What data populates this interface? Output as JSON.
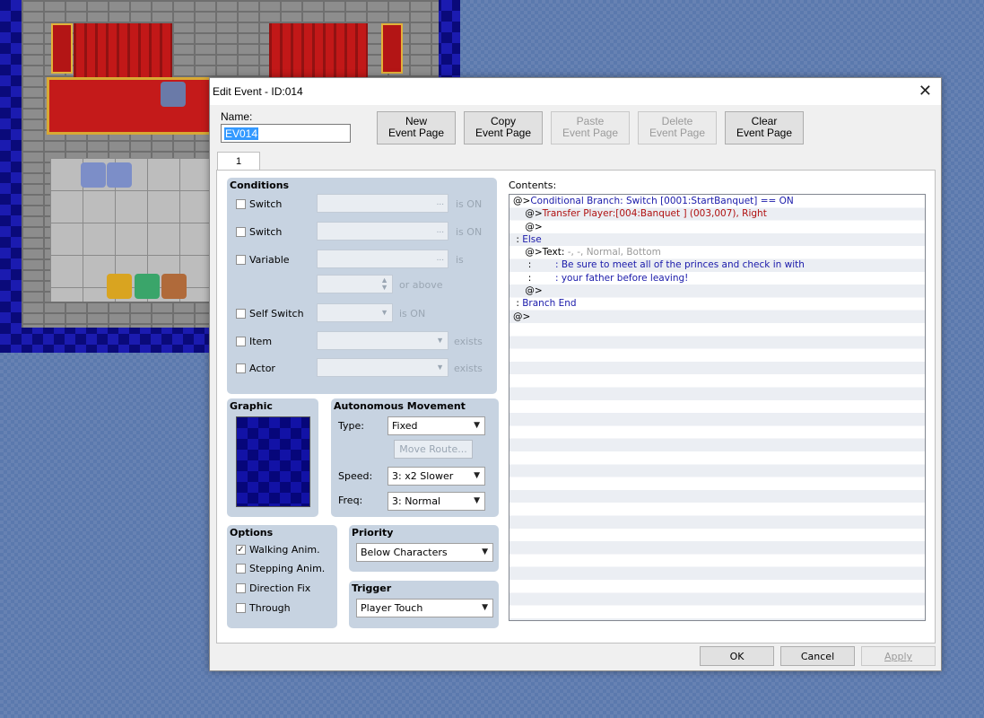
{
  "window": {
    "title": "Edit Event - ID:014",
    "close_glyph": "✕"
  },
  "name_label": "Name:",
  "name_value": "EV014",
  "page_buttons": [
    {
      "line1": "New",
      "line2": "Event Page"
    },
    {
      "line1": "Copy",
      "line2": "Event Page"
    },
    {
      "line1": "Paste",
      "line2": "Event Page"
    },
    {
      "line1": "Delete",
      "line2": "Event Page"
    },
    {
      "line1": "Clear",
      "line2": "Event Page"
    }
  ],
  "tab_label": "1",
  "conditions": {
    "title": "Conditions",
    "switch1_label": "Switch",
    "switch1_suffix": "is ON",
    "switch2_label": "Switch",
    "switch2_suffix": "is ON",
    "variable_label": "Variable",
    "variable_suffix": "is",
    "or_above": "or above",
    "self_switch_label": "Self Switch",
    "self_switch_suffix": "is ON",
    "item_label": "Item",
    "item_suffix": "exists",
    "actor_label": "Actor",
    "actor_suffix": "exists",
    "ellipsis": "..."
  },
  "graphic": {
    "title": "Graphic"
  },
  "autonomous": {
    "title": "Autonomous Movement",
    "type_label": "Type:",
    "type_value": "Fixed",
    "move_route": "Move Route...",
    "speed_label": "Speed:",
    "speed_value": "3: x2 Slower",
    "freq_label": "Freq:",
    "freq_value": "3: Normal"
  },
  "options": {
    "title": "Options",
    "walking": "Walking Anim.",
    "walking_checked": "✓",
    "stepping": "Stepping Anim.",
    "direction_fix": "Direction Fix",
    "through": "Through"
  },
  "priority": {
    "title": "Priority",
    "value": "Below Characters"
  },
  "trigger": {
    "title": "Trigger",
    "value": "Player Touch"
  },
  "contents": {
    "label": "Contents:",
    "lines": {
      "l0a": "@>",
      "l0b": "Conditional Branch: Switch [0001:StartBanquet] == ON",
      "l1a": "    @>",
      "l1b": "Transfer Player:[004:Banquet ] (003,007), Right",
      "l2": "    @>",
      "l3a": " : ",
      "l3b": "Else",
      "l4a": "    @>Text:",
      "l4b": " -, -, Normal, Bottom",
      "l5a": "     :        ",
      "l5b": ": Be sure to meet all of the princes and check in with",
      "l6a": "     :        ",
      "l6b": ": your father before leaving!",
      "l7": "    @>",
      "l8a": " : ",
      "l8b": "Branch End",
      "l9": "@>"
    }
  },
  "footer": {
    "ok": "OK",
    "cancel": "Cancel",
    "apply": "Apply"
  },
  "colors": {
    "blue_text": "#1a1aaa",
    "red_text": "#b01010",
    "gray_text": "#9a9a9a"
  }
}
